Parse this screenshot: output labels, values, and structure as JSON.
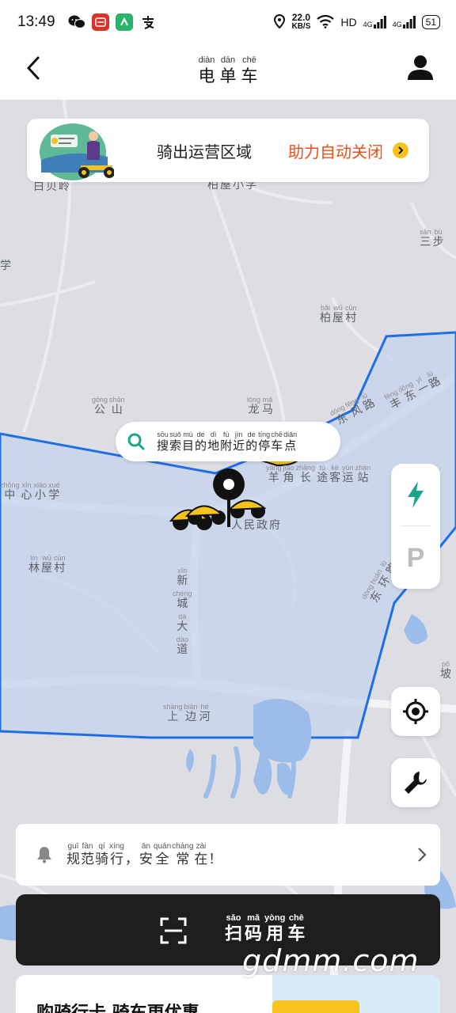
{
  "status_bar": {
    "time": "13:49",
    "net_speed_value": "22.0",
    "net_speed_unit": "KB/S",
    "hd_label": "HD",
    "signal_1": "4G",
    "signal_2": "4G",
    "battery": "51"
  },
  "header": {
    "title": [
      {
        "py": "diàn",
        "hz": "电"
      },
      {
        "py": "dān",
        "hz": "单"
      },
      {
        "py": "chē",
        "hz": "车"
      }
    ]
  },
  "banner": {
    "text_main": "骑出运营区域",
    "text_highlight": "助力自动关闭",
    "highlight_color": "#e8521a"
  },
  "search": {
    "placeholder": [
      {
        "py": "sōu",
        "hz": "搜"
      },
      {
        "py": "suǒ",
        "hz": "索"
      },
      {
        "py": "mù",
        "hz": "目"
      },
      {
        "py": "de",
        "hz": "的"
      },
      {
        "py": "dì",
        "hz": "地"
      },
      {
        "py": "fù",
        "hz": "附"
      },
      {
        "py": "jìn",
        "hz": "近"
      },
      {
        "py": "de",
        "hz": "的"
      },
      {
        "py": "tíng",
        "hz": "停"
      },
      {
        "py": "chē",
        "hz": "车"
      },
      {
        "py": "diǎn",
        "hz": "点"
      }
    ]
  },
  "map": {
    "zone_color": "#1e6ee8",
    "labels": [
      {
        "id": "baibeiling",
        "chars": [
          {
            "py": "",
            "hz": "白"
          },
          {
            "py": "",
            "hz": "贝"
          },
          {
            "py": "",
            "hz": "岭"
          }
        ]
      },
      {
        "id": "baiwuxiaoxue",
        "chars": [
          {
            "py": "",
            "hz": "柏"
          },
          {
            "py": "",
            "hz": "屋"
          },
          {
            "py": "",
            "hz": "小"
          },
          {
            "py": "",
            "hz": "学"
          }
        ]
      },
      {
        "id": "sanbu",
        "chars": [
          {
            "py": "sān",
            "hz": "三"
          },
          {
            "py": "bù",
            "hz": "步"
          }
        ]
      },
      {
        "id": "xue-left",
        "chars": [
          {
            "py": "",
            "hz": "学"
          }
        ]
      },
      {
        "id": "baiwucun",
        "chars": [
          {
            "py": "bǎi",
            "hz": "柏"
          },
          {
            "py": "wū",
            "hz": "屋"
          },
          {
            "py": "cūn",
            "hz": "村"
          }
        ]
      },
      {
        "id": "gongshan",
        "chars": [
          {
            "py": "gōng",
            "hz": "公"
          },
          {
            "py": "shān",
            "hz": "山"
          }
        ]
      },
      {
        "id": "longma",
        "chars": [
          {
            "py": "lóng",
            "hz": "龙"
          },
          {
            "py": "mǎ",
            "hz": "马"
          }
        ]
      },
      {
        "id": "dongfenglu",
        "chars": [
          {
            "py": "dōng",
            "hz": "东"
          },
          {
            "py": "fēng",
            "hz": "风"
          },
          {
            "py": "lù",
            "hz": "路"
          }
        ]
      },
      {
        "id": "fengdongyilu",
        "chars": [
          {
            "py": "fēng",
            "hz": "丰"
          },
          {
            "py": "dōng",
            "hz": "东"
          },
          {
            "py": "yī",
            "hz": "一"
          },
          {
            "py": "lù",
            "hz": "路"
          }
        ]
      },
      {
        "id": "zhongxiaoxue",
        "chars": [
          {
            "py": "zhōng",
            "hz": "中"
          },
          {
            "py": "xīn",
            "hz": "心"
          },
          {
            "py": "xiǎo",
            "hz": "小"
          },
          {
            "py": "xué",
            "hz": "学"
          }
        ]
      },
      {
        "id": "yangjiaozhang",
        "chars": [
          {
            "py": "yáng",
            "hz": "羊"
          },
          {
            "py": "jiǎo",
            "hz": "角"
          },
          {
            "py": "zhǎng",
            "hz": "长"
          },
          {
            "py": "tú",
            "hz": "途"
          },
          {
            "py": "kè",
            "hz": "客"
          },
          {
            "py": "yùn",
            "hz": "运"
          },
          {
            "py": "zhàn",
            "hz": "站"
          }
        ]
      },
      {
        "id": "renminzhengfu",
        "chars": [
          {
            "py": "",
            "hz": "人"
          },
          {
            "py": "",
            "hz": "民"
          },
          {
            "py": "",
            "hz": "政"
          },
          {
            "py": "",
            "hz": "府"
          }
        ]
      },
      {
        "id": "linwucun",
        "chars": [
          {
            "py": "lín",
            "hz": "林"
          },
          {
            "py": "wū",
            "hz": "屋"
          },
          {
            "py": "cūn",
            "hz": "村"
          }
        ]
      },
      {
        "id": "xinchengdadao",
        "chars": [
          {
            "py": "xīn",
            "hz": "新"
          },
          {
            "py": "chéng",
            "hz": "城"
          },
          {
            "py": "dà",
            "hz": "大"
          },
          {
            "py": "dào",
            "hz": "道"
          }
        ]
      },
      {
        "id": "donghuanlu",
        "chars": [
          {
            "py": "dōng",
            "hz": "东"
          },
          {
            "py": "huán",
            "hz": "环"
          },
          {
            "py": "lù",
            "hz": "路"
          }
        ]
      },
      {
        "id": "po",
        "chars": [
          {
            "py": "pō",
            "hz": "坡"
          }
        ]
      },
      {
        "id": "shangbianhe",
        "chars": [
          {
            "py": "shàng",
            "hz": "上"
          },
          {
            "py": "biān",
            "hz": "边"
          },
          {
            "py": "hé",
            "hz": "河"
          }
        ]
      }
    ]
  },
  "side_controls": {
    "power_icon": "lightning-icon",
    "parking_label": "P",
    "power_color": "#1aa689"
  },
  "notice": {
    "text": [
      {
        "py": "guī",
        "hz": "规"
      },
      {
        "py": "fàn",
        "hz": "范"
      },
      {
        "py": "qí",
        "hz": "骑"
      },
      {
        "py": "xíng",
        "hz": "行"
      },
      {
        "py": "",
        "hz": "，"
      },
      {
        "py": "ān",
        "hz": "安"
      },
      {
        "py": "quán",
        "hz": "全"
      },
      {
        "py": "cháng",
        "hz": "常"
      },
      {
        "py": "zài",
        "hz": "在"
      },
      {
        "py": "",
        "hz": "！"
      }
    ]
  },
  "scan": {
    "label": [
      {
        "py": "sǎo",
        "hz": "扫"
      },
      {
        "py": "mǎ",
        "hz": "码"
      },
      {
        "py": "yòng",
        "hz": "用"
      },
      {
        "py": "chē",
        "hz": "车"
      }
    ]
  },
  "promo": {
    "text": "购骑行卡 骑车更优惠"
  },
  "watermark": "gdmm.com"
}
